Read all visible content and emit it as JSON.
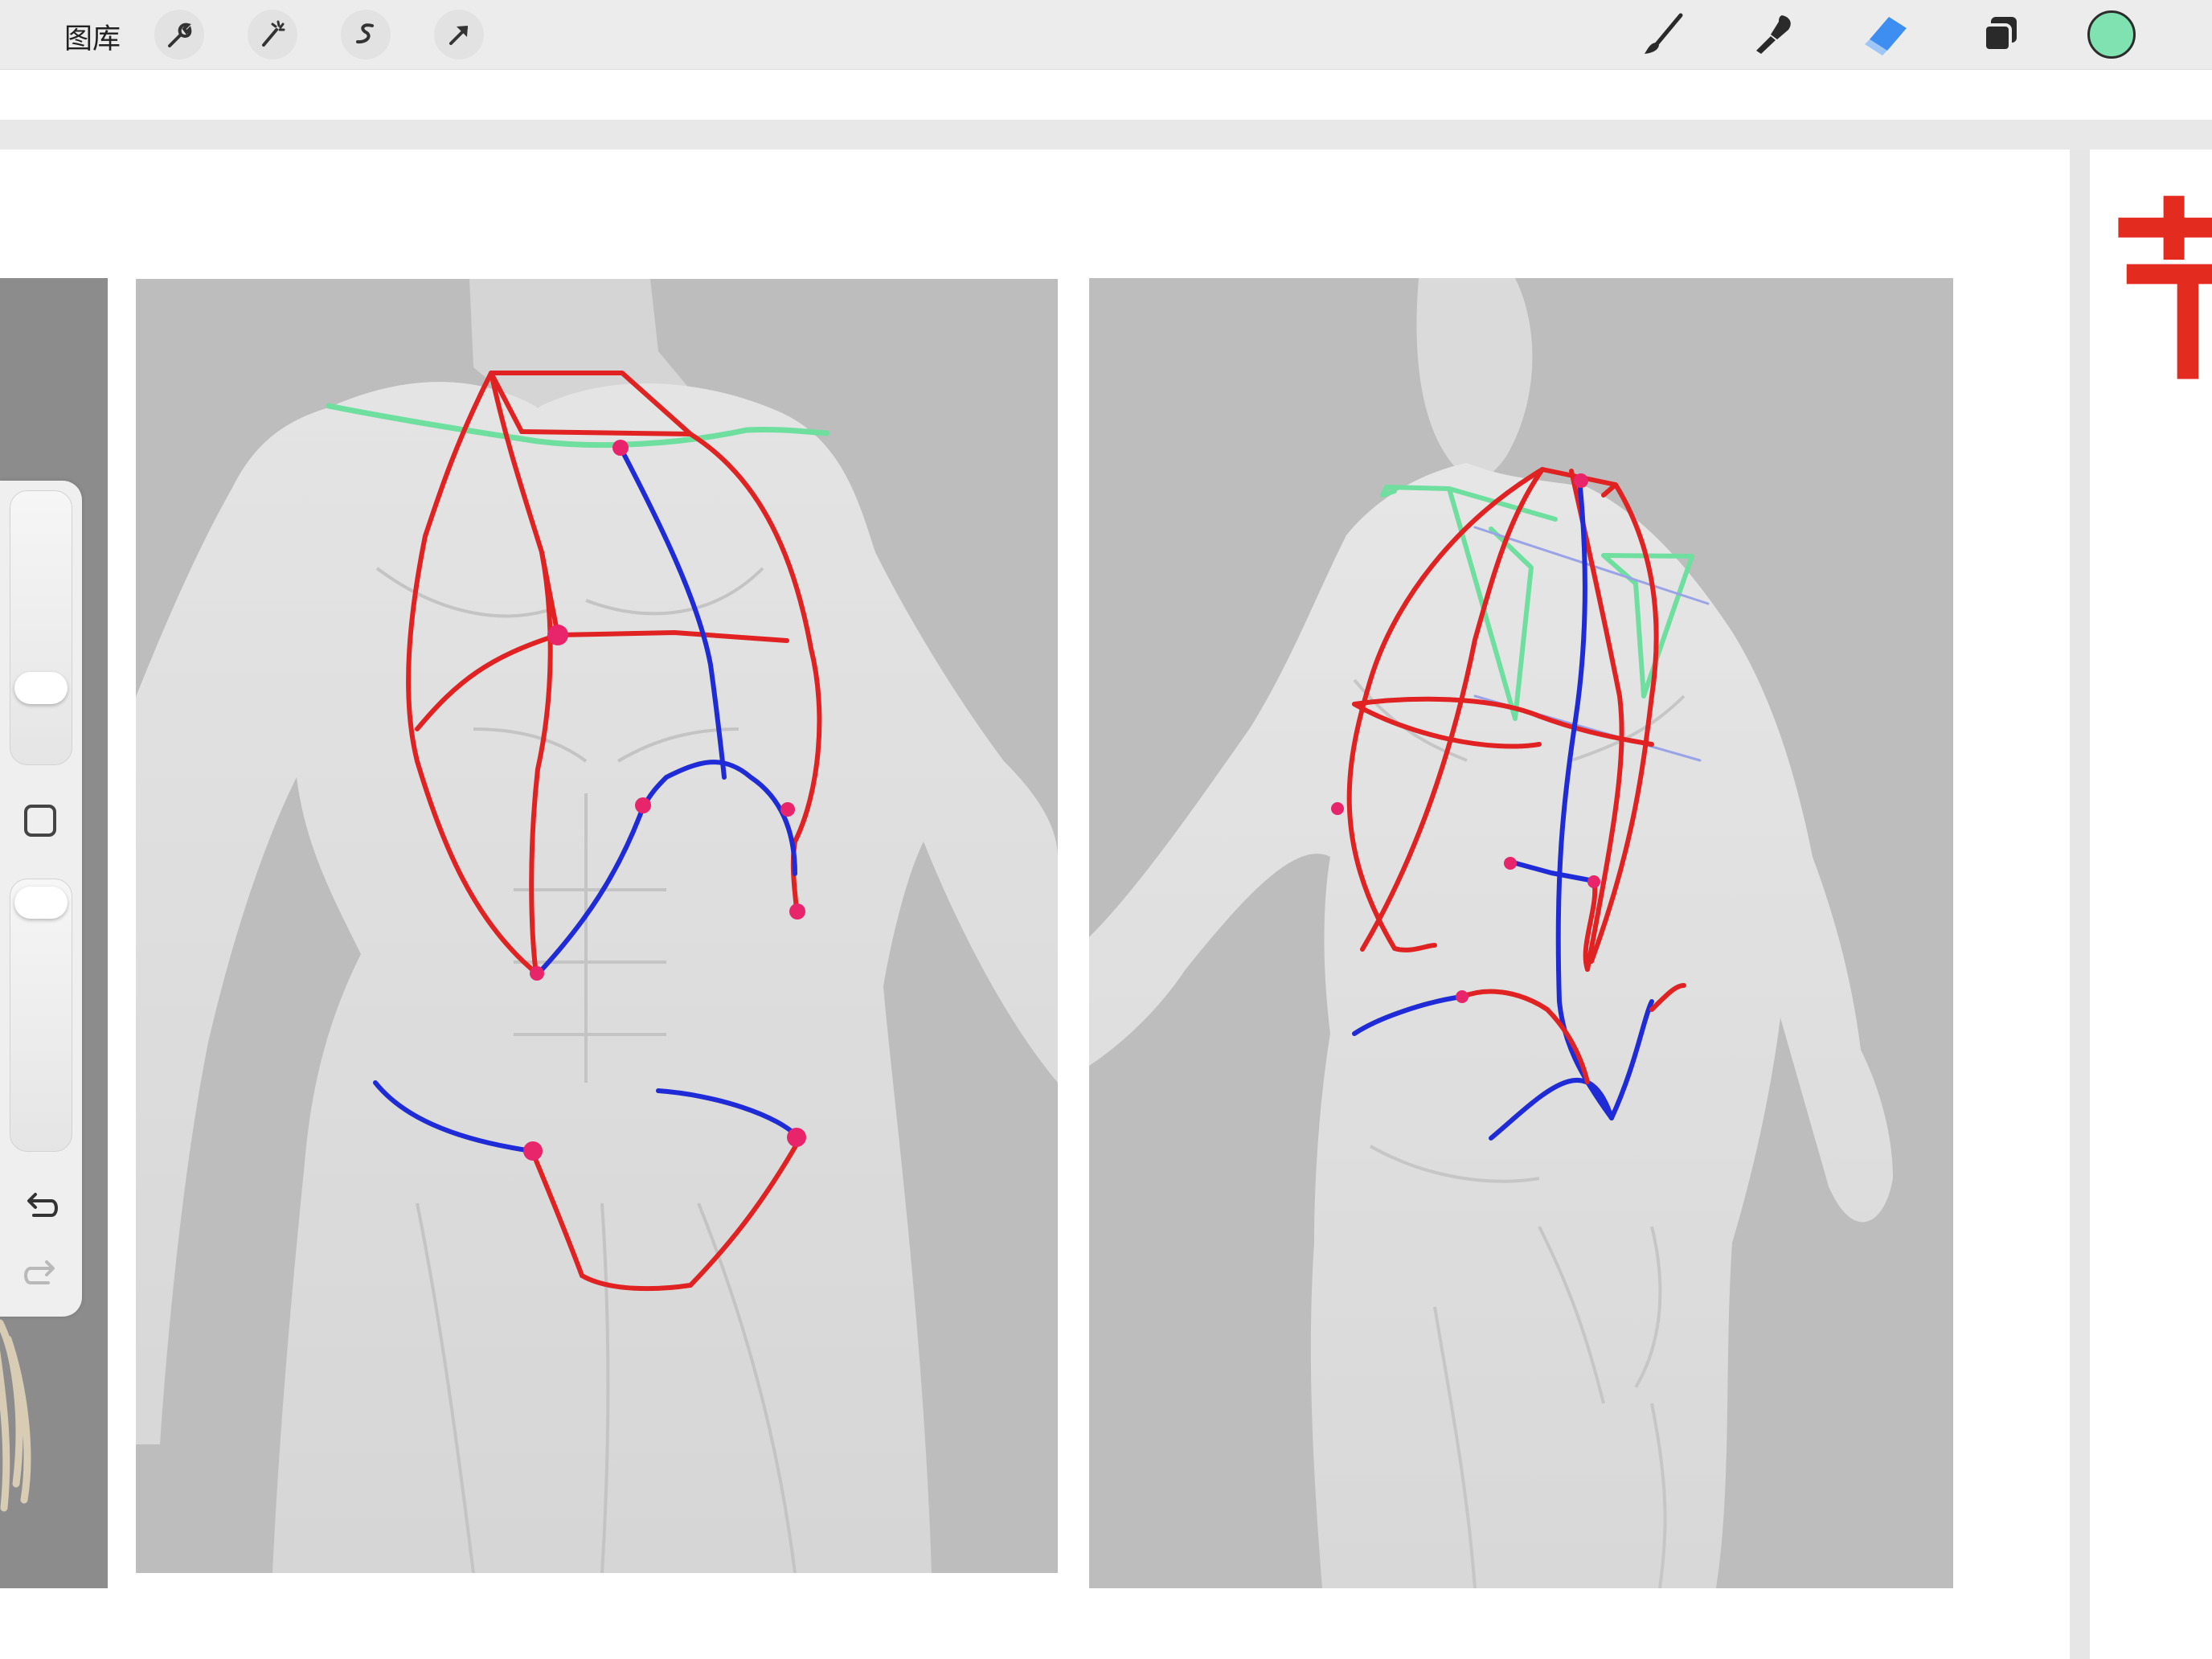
{
  "toolbar": {
    "gallery_label": "图库",
    "left_tools": [
      "wrench-icon",
      "magic-wand-icon",
      "selection-icon",
      "transform-arrow-icon"
    ],
    "right_tools": [
      "brush-icon",
      "smudge-icon",
      "eraser-icon",
      "layers-icon"
    ],
    "active_tool": "eraser",
    "color": "#7fe2b0"
  },
  "side_panel": {
    "controls": [
      "brush-size-slider",
      "modify-button",
      "opacity-slider",
      "undo-button",
      "redo-button"
    ]
  },
  "canvas": {
    "next_page_char": "节",
    "stroke_colors": {
      "red": "#e02222",
      "blue": "#1f2bd6",
      "green": "#6fdf9f",
      "magenta": "#e8246a"
    }
  }
}
